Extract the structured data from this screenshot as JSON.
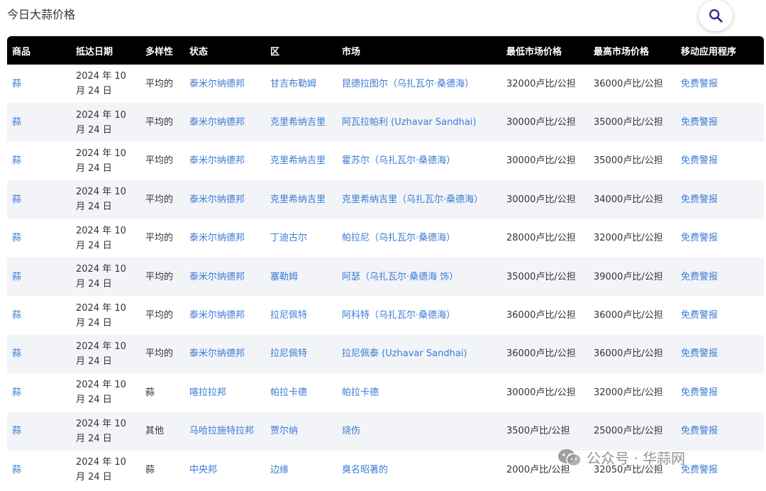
{
  "page": {
    "title": "今日大蒜价格"
  },
  "search": {
    "icon": "search-icon"
  },
  "table": {
    "headers": [
      "商品",
      "抵达日期",
      "多样性",
      "状态",
      "区",
      "市场",
      "最低市场价格",
      "最高市场价格",
      "移动应用程序"
    ],
    "rows": [
      [
        "蒜",
        "2024 年 10 月 24 日",
        "平均的",
        "泰米尔纳德邦",
        "甘吉布勒姆",
        "昆德拉图尔（乌扎瓦尔·桑德海）",
        "32000卢比/公担",
        "36000卢比/公担",
        "免费警报"
      ],
      [
        "蒜",
        "2024 年 10 月 24 日",
        "平均的",
        "泰米尔纳德邦",
        "克里希纳吉里",
        "阿瓦拉帕利 (Uzhavar Sandhai)",
        "30000卢比/公担",
        "35000卢比/公担",
        "免费警报"
      ],
      [
        "蒜",
        "2024 年 10 月 24 日",
        "平均的",
        "泰米尔纳德邦",
        "克里希纳吉里",
        "霍苏尔（乌扎瓦尔·桑德海）",
        "30000卢比/公担",
        "35000卢比/公担",
        "免费警报"
      ],
      [
        "蒜",
        "2024 年 10 月 24 日",
        "平均的",
        "泰米尔纳德邦",
        "克里希纳吉里",
        "克里希纳吉里（乌扎瓦尔·桑德海）",
        "30000卢比/公担",
        "34000卢比/公担",
        "免费警报"
      ],
      [
        "蒜",
        "2024 年 10 月 24 日",
        "平均的",
        "泰米尔纳德邦",
        "丁迪古尔",
        "帕拉尼（乌扎瓦尔·桑德海）",
        "28000卢比/公担",
        "32000卢比/公担",
        "免费警报"
      ],
      [
        "蒜",
        "2024 年 10 月 24 日",
        "平均的",
        "泰米尔纳德邦",
        "塞勒姆",
        "阿瑟（乌扎瓦尔·桑德海 饰）",
        "35000卢比/公担",
        "39000卢比/公担",
        "免费警报"
      ],
      [
        "蒜",
        "2024 年 10 月 24 日",
        "平均的",
        "泰米尔纳德邦",
        "拉尼佩特",
        "阿科特（乌扎瓦尔·桑德海）",
        "36000卢比/公担",
        "36000卢比/公担",
        "免费警报"
      ],
      [
        "蒜",
        "2024 年 10 月 24 日",
        "平均的",
        "泰米尔纳德邦",
        "拉尼佩特",
        "拉尼佩泰 (Uzhavar Sandhai)",
        "36000卢比/公担",
        "36000卢比/公担",
        "免费警报"
      ],
      [
        "蒜",
        "2024 年 10 月 24 日",
        "蒜",
        "喀拉拉邦",
        "帕拉卡德",
        "帕拉卡德",
        "30000卢比/公担",
        "32000卢比/公担",
        "免费警报"
      ],
      [
        "蒜",
        "2024 年 10 月 24 日",
        "其他",
        "马哈拉施特拉邦",
        "贾尔纳",
        "烧伤",
        "3500卢比/公担",
        "25000卢比/公担",
        "免费警报"
      ],
      [
        "蒜",
        "2024 年 10 月 24 日",
        "蒜",
        "中央邦",
        "边缘",
        "臭名昭著的",
        "2000卢比/公担",
        "32050卢比/公担",
        "免费警报"
      ]
    ]
  },
  "watermark": {
    "text": "公众号 · 华蒜网",
    "icon": "wechat-icon"
  }
}
